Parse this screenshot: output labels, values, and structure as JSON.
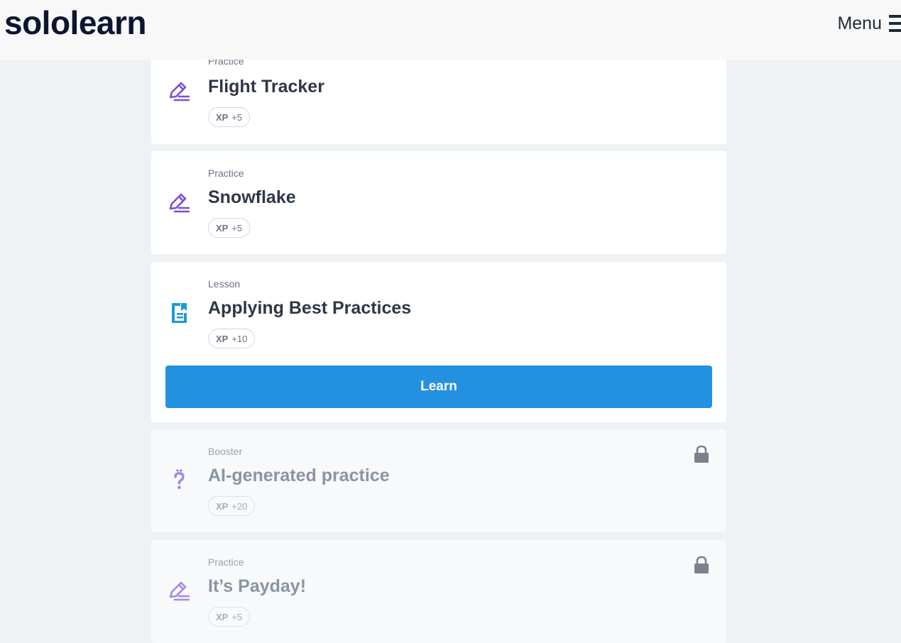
{
  "header": {
    "logo_text": "sololearn",
    "menu_label": "Menu"
  },
  "cards": [
    {
      "type": "Practice",
      "title": "Flight Tracker",
      "xp_label": "XP",
      "xp_value": "+5",
      "icon": "pencil-practice-icon",
      "locked": false
    },
    {
      "type": "Practice",
      "title": "Snowflake",
      "xp_label": "XP",
      "xp_value": "+5",
      "icon": "pencil-practice-icon",
      "locked": false
    },
    {
      "type": "Lesson",
      "title": "Applying Best Practices",
      "xp_label": "XP",
      "xp_value": "+10",
      "icon": "lesson-document-icon",
      "locked": false,
      "button_label": "Learn"
    },
    {
      "type": "Booster",
      "title": "AI-generated practice",
      "xp_label": "XP",
      "xp_value": "+20",
      "icon": "question-mark-icon",
      "locked": true
    },
    {
      "type": "Practice",
      "title": "It’s Payday!",
      "xp_label": "XP",
      "xp_value": "+5",
      "icon": "pencil-practice-icon",
      "locked": true
    }
  ],
  "colors": {
    "accent": "#2491e0",
    "practice_icon": "#7e4fd6",
    "lesson_icon": "#1e9ad6",
    "lock_icon": "#7b828c"
  }
}
